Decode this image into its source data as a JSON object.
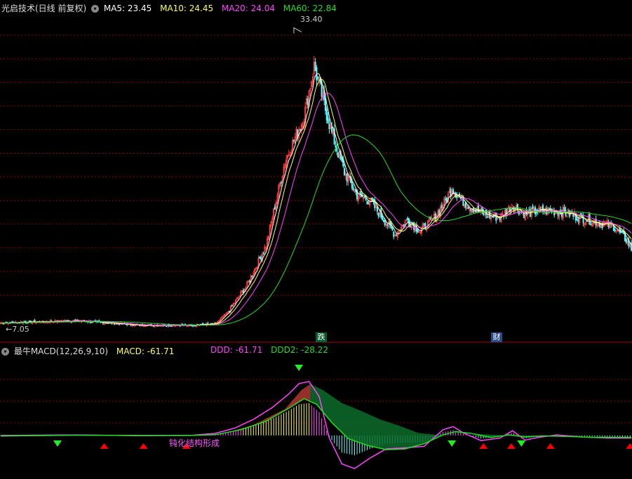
{
  "main_header": {
    "title": "光启技术(日线 前复权)",
    "ma5": "MA5: 23.45",
    "ma10": "MA10: 24.45",
    "ma20": "MA20: 24.04",
    "ma60": "MA60: 22.84"
  },
  "macd_header": {
    "title": "最牛MACD(12,26,9,10)",
    "macd": "MACD: -61.71",
    "ddd": "DDD: -61.71",
    "ddd2": "DDD2: -28.22"
  },
  "annotations": {
    "high_price": "33.40",
    "low_price": "7.05",
    "event_1": "跌",
    "event_2": "财",
    "signal_text": "钝化结构形成"
  },
  "colors": {
    "up": "#ff3c3c",
    "down": "#54ffff",
    "ma5": "#ffffff",
    "ma10": "#ffff55",
    "ma20": "#ff44ff",
    "ma60": "#22dd22",
    "grid": "#8b0000",
    "area_up": "#a52a2a",
    "area_down": "#0d6b2a"
  },
  "chart_data": [
    {
      "type": "candlestick",
      "title": "光启技术(日线 前复权)",
      "price_range": [
        6.5,
        35.0
      ],
      "max_point": 33.4,
      "min_point": 7.05,
      "close_anchors": [
        [
          0,
          7.6
        ],
        [
          60,
          7.8
        ],
        [
          110,
          7.4
        ],
        [
          150,
          7.4
        ],
        [
          170,
          7.5
        ],
        [
          180,
          8.6
        ],
        [
          195,
          11.0
        ],
        [
          210,
          14.5
        ],
        [
          225,
          22.0
        ],
        [
          240,
          26.0
        ],
        [
          248,
          30.5
        ],
        [
          255,
          27.5
        ],
        [
          262,
          24.5
        ],
        [
          272,
          21.0
        ],
        [
          282,
          19.0
        ],
        [
          292,
          18.5
        ],
        [
          302,
          17.0
        ],
        [
          312,
          15.5
        ],
        [
          322,
          16.8
        ],
        [
          332,
          15.8
        ],
        [
          342,
          16.8
        ],
        [
          352,
          18.5
        ],
        [
          357,
          19.6
        ],
        [
          365,
          18.5
        ],
        [
          375,
          17.7
        ],
        [
          385,
          17.2
        ],
        [
          395,
          17.0
        ],
        [
          405,
          18.1
        ],
        [
          415,
          17.3
        ],
        [
          425,
          17.6
        ],
        [
          435,
          17.6
        ],
        [
          445,
          17.5
        ],
        [
          455,
          17.1
        ],
        [
          465,
          16.8
        ],
        [
          475,
          16.5
        ],
        [
          485,
          16.2
        ],
        [
          495,
          15.0
        ],
        [
          500,
          14.0
        ]
      ],
      "ma_lines": [
        {
          "name": "MA5",
          "value": 23.45
        },
        {
          "name": "MA10",
          "value": 24.45
        },
        {
          "name": "MA20",
          "value": 24.04
        },
        {
          "name": "MA60",
          "value": 22.84
        }
      ]
    },
    {
      "type": "macd",
      "title": "最牛MACD(12,26,9,10)",
      "values": {
        "MACD": -61.71,
        "DDD": -61.71,
        "DDD2": -28.22
      },
      "y_range": [
        -160,
        300
      ],
      "ddd_anchors": [
        [
          0,
          0
        ],
        [
          60,
          2
        ],
        [
          110,
          -1
        ],
        [
          150,
          0
        ],
        [
          170,
          8
        ],
        [
          185,
          28
        ],
        [
          200,
          62
        ],
        [
          215,
          108
        ],
        [
          228,
          160
        ],
        [
          236,
          200
        ],
        [
          244,
          208
        ],
        [
          252,
          150
        ],
        [
          260,
          -10
        ],
        [
          270,
          -110
        ],
        [
          280,
          -128
        ],
        [
          292,
          -88
        ],
        [
          305,
          -52
        ],
        [
          320,
          -48
        ],
        [
          335,
          -42
        ],
        [
          350,
          22
        ],
        [
          358,
          34
        ],
        [
          366,
          10
        ],
        [
          380,
          -20
        ],
        [
          395,
          -10
        ],
        [
          405,
          18
        ],
        [
          415,
          -18
        ],
        [
          425,
          -8
        ],
        [
          440,
          2
        ],
        [
          460,
          -6
        ],
        [
          480,
          -10
        ],
        [
          500,
          -10
        ]
      ],
      "ddd2_anchors": [
        [
          0,
          -2
        ],
        [
          60,
          1
        ],
        [
          110,
          0
        ],
        [
          150,
          0
        ],
        [
          170,
          3
        ],
        [
          190,
          22
        ],
        [
          210,
          55
        ],
        [
          228,
          105
        ],
        [
          240,
          142
        ],
        [
          250,
          120
        ],
        [
          262,
          50
        ],
        [
          275,
          -12
        ],
        [
          290,
          -38
        ],
        [
          305,
          -55
        ],
        [
          320,
          -52
        ],
        [
          335,
          -32
        ],
        [
          350,
          2
        ],
        [
          360,
          15
        ],
        [
          372,
          8
        ],
        [
          388,
          -8
        ],
        [
          402,
          2
        ],
        [
          415,
          -6
        ],
        [
          430,
          -2
        ],
        [
          450,
          -4
        ],
        [
          470,
          -8
        ],
        [
          500,
          -8
        ]
      ],
      "slow_anchors": [
        [
          0,
          -5
        ],
        [
          60,
          -1
        ],
        [
          110,
          -1
        ],
        [
          150,
          0
        ],
        [
          175,
          6
        ],
        [
          200,
          40
        ],
        [
          225,
          102
        ],
        [
          238,
          175
        ],
        [
          245,
          198
        ],
        [
          255,
          175
        ],
        [
          270,
          125
        ],
        [
          285,
          95
        ],
        [
          300,
          62
        ],
        [
          315,
          38
        ],
        [
          330,
          10
        ],
        [
          345,
          2
        ],
        [
          360,
          10
        ],
        [
          380,
          5
        ],
        [
          400,
          0
        ],
        [
          420,
          0
        ],
        [
          440,
          -2
        ],
        [
          460,
          -4
        ],
        [
          480,
          -6
        ],
        [
          500,
          -6
        ]
      ],
      "up_signals": [
        82,
        113,
        147,
        382,
        404,
        435,
        498
      ],
      "down_signals": [
        45,
        236,
        357,
        412
      ]
    }
  ]
}
